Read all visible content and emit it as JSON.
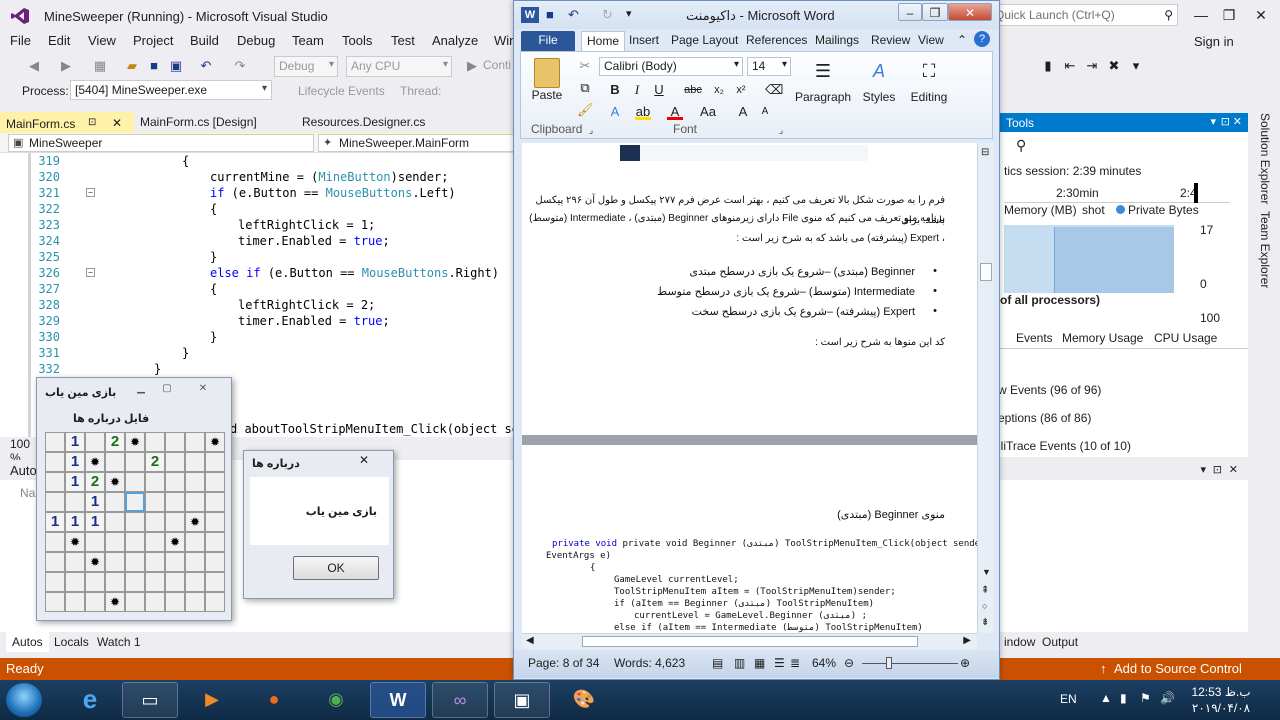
{
  "vs": {
    "title": "MineSweeper (Running) - Microsoft Visual Studio",
    "quick_launch": "Quick Launch (Ctrl+Q)",
    "sign_in": "Sign in",
    "menu": [
      "File",
      "Edit",
      "View",
      "Project",
      "Build",
      "Debug",
      "Team",
      "Tools",
      "Test",
      "Analyze",
      "Win"
    ],
    "toolbar": {
      "config": "Debug",
      "platform": "Any CPU",
      "continue": "Conti"
    },
    "debugbar": {
      "process_label": "Process:",
      "process_value": "[5404] MineSweeper.exe",
      "lifecycle": "Lifecycle Events",
      "thread": "Thread:"
    },
    "tabs": [
      "MainForm.cs",
      "MainForm.cs [Design]",
      "Resources.Designer.cs"
    ],
    "nav": {
      "project": "MineSweeper",
      "class": "MineSweeper.MainForm"
    },
    "code_lines": [
      {
        "n": "319",
        "c": "{"
      },
      {
        "n": "320",
        "c": "currentMine = (MineButton)sender;"
      },
      {
        "n": "321",
        "c": "if (e.Button == MouseButtons.Left)"
      },
      {
        "n": "322",
        "c": "{"
      },
      {
        "n": "323",
        "c": "leftRightClick = 1;"
      },
      {
        "n": "324",
        "c": "timer.Enabled = true;"
      },
      {
        "n": "325",
        "c": "}"
      },
      {
        "n": "326",
        "c": "else if (e.Button == MouseButtons.Right)"
      },
      {
        "n": "327",
        "c": "{"
      },
      {
        "n": "328",
        "c": "leftRightClick = 2;"
      },
      {
        "n": "329",
        "c": "timer.Enabled = true;"
      },
      {
        "n": "330",
        "c": "}"
      },
      {
        "n": "331",
        "c": "}"
      },
      {
        "n": "332",
        "c": "}"
      }
    ],
    "hidden_line": "d aboutToolStripMenuItem_Click(object se",
    "zoom": "100 %",
    "autos": {
      "title": "Autos",
      "col": "Na"
    },
    "bottom_tabs": [
      "Autos",
      "Locals",
      "Watch 1"
    ],
    "diag": {
      "title": "Tools",
      "session": "tics session: 2:39 minutes",
      "timeline_a": "2:30min",
      "timeline_b": "2:4",
      "memory_label": "Memory (MB)",
      "snapshot": "shot",
      "private_bytes": "Private Bytes",
      "mem_hi": "17",
      "mem_lo": "0",
      "cpu_label": "of all processors)",
      "cpu_hi": "100",
      "tabs": [
        "Events",
        "Memory Usage",
        "CPU Usage"
      ],
      "events": [
        "w Events (96 of 96)",
        "eptions (86 of 86)",
        "lliTrace Events (10 of 10)"
      ]
    },
    "side_tabs": [
      "Solution Explorer",
      "Team Explorer"
    ],
    "output_tabs": [
      "indow",
      "Output"
    ],
    "status": {
      "ready": "Ready",
      "add_source": "Add to Source Control"
    }
  },
  "word": {
    "title": "داکیومنت  -  Microsoft Word",
    "tabs": [
      "File",
      "Home",
      "Insert",
      "Page Layout",
      "References",
      "Mailings",
      "Review",
      "View"
    ],
    "font": "Calibri (Body)",
    "size": "14",
    "groups": {
      "clipboard": "Clipboard",
      "font": "Font",
      "paste": "Paste",
      "paragraph": "Paragraph",
      "styles": "Styles",
      "editing": "Editing"
    },
    "doc": {
      "para1": "فرم را به صورت شکل بالا تعریف می کنیم ، بهتر است عرض فرم ۲۷۷ پیکسل و طول آن ۲۹۶ پیکسل باشد. برای",
      "para2": "برنامه منو تعریف می کنیم که منوی File دارای زیرمنوهای Beginner (مبتدی) ، Intermediate (متوسط)",
      "para3": "، Expert (پیشرفته) می باشد که به شرح زیر است :",
      "bullets": [
        "Beginner (مبتدی) –شروع یک بازی درسطح مبتدی",
        "Intermediate (متوسط) –شروع یک بازی درسطح متوسط",
        "Expert (پیشرفته) –شروع یک بازی درسطح سخت"
      ],
      "para4": "کد این منوها به شرح زیر است :",
      "menu_heading": "منوی Beginner (مبتدی)",
      "code": [
        "private void Beginner (مبتدی) ToolStripMenuItem_Click(object sender,",
        "EventArgs e)",
        "{",
        "GameLevel currentLevel;",
        "ToolStripMenuItem aItem = (ToolStripMenuItem)sender;",
        "if (aItem == Beginner (مبتدی) ToolStripMenuItem)",
        "currentLevel = GameLevel.Beginner (مبتدی) ;",
        "else if (aItem == Intermediate (متوسط) ToolStripMenuItem)"
      ]
    },
    "status": {
      "page": "Page: 8 of 34",
      "words": "Words: 4,623",
      "zoom": "64%"
    }
  },
  "mine": {
    "title": "بازی مین یاب",
    "menu": [
      "فایل",
      "درباره ها"
    ],
    "grid": [
      [
        "",
        "1",
        "",
        "2",
        "*",
        "",
        "",
        "",
        "*"
      ],
      [
        "",
        "1",
        "*",
        "",
        "",
        "2",
        "",
        "",
        ""
      ],
      [
        "",
        "1",
        "2",
        "*",
        "",
        "",
        "",
        "",
        ""
      ],
      [
        "",
        "",
        "1",
        "",
        "S",
        "",
        "",
        "",
        ""
      ],
      [
        "1",
        "1",
        "1",
        "",
        "",
        "",
        "",
        "*",
        ""
      ],
      [
        "",
        "*",
        "",
        "",
        "",
        "",
        "*",
        "",
        ""
      ],
      [
        "",
        "",
        "*",
        "",
        "",
        "",
        "",
        "",
        ""
      ],
      [
        "",
        "",
        "",
        "",
        "",
        "",
        "",
        "",
        ""
      ],
      [
        "",
        "",
        "",
        "*",
        "",
        "",
        "",
        "",
        ""
      ]
    ]
  },
  "about": {
    "title": "درباره ها",
    "message": "بازی مین یاب",
    "ok": "OK"
  },
  "taskbar": {
    "lang": "EN",
    "time": "12:53 ب.ظ",
    "date": "۲۰۱۹/۰۴/۰۸"
  }
}
